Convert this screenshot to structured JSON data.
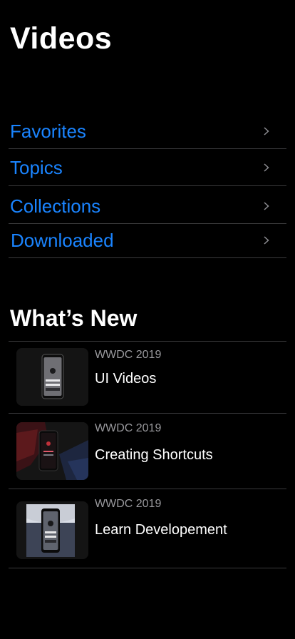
{
  "header": {
    "title": "Videos"
  },
  "nav": {
    "items": [
      {
        "label": "Favorites",
        "icon": "chevron-right-icon"
      },
      {
        "label": "Topics",
        "icon": "chevron-right-icon"
      },
      {
        "label": "Collections",
        "icon": "chevron-right-icon"
      },
      {
        "label": "Downloaded",
        "icon": "chevron-right-icon"
      }
    ]
  },
  "whats_new": {
    "title": "What’s New",
    "videos": [
      {
        "event": "WWDC 2019",
        "title": "UI Videos",
        "thumbnail": "phone-thumbnail-icon"
      },
      {
        "event": "WWDC 2019",
        "title": "Creating Shortcuts",
        "thumbnail": "phone-thumbnail-icon"
      },
      {
        "event": "WWDC 2019",
        "title": "Learn Developement",
        "thumbnail": "phone-thumbnail-icon"
      }
    ]
  },
  "colors": {
    "background": "#000000",
    "accent": "#1a84ff",
    "separator": "#3a3a3c",
    "secondary_text": "#9a9a9e"
  }
}
